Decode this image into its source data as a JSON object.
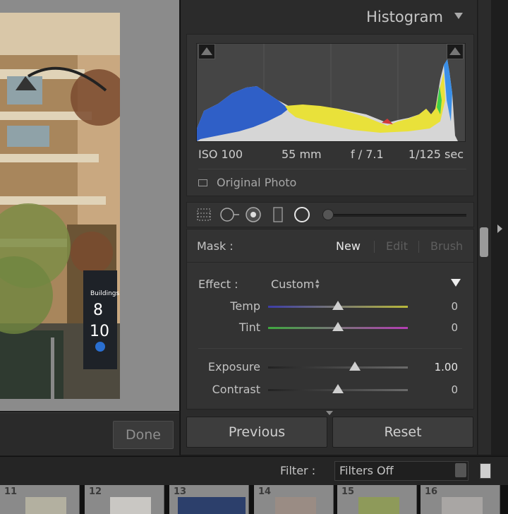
{
  "histogram": {
    "title": "Histogram",
    "iso": "ISO 100",
    "focal": "55 mm",
    "aperture": "f / 7.1",
    "shutter": "1/125 sec",
    "original_photo_label": "Original Photo"
  },
  "mask": {
    "label": "Mask :",
    "new": "New",
    "edit": "Edit",
    "brush": "Brush"
  },
  "effect": {
    "label": "Effect :",
    "value": "Custom"
  },
  "sliders": {
    "temp": {
      "label": "Temp",
      "value": "0",
      "position": 0.5
    },
    "tint": {
      "label": "Tint",
      "value": "0",
      "position": 0.5
    },
    "exposure": {
      "label": "Exposure",
      "value": "1.00",
      "position": 0.62
    },
    "contrast": {
      "label": "Contrast",
      "value": "0",
      "position": 0.5
    }
  },
  "buttons": {
    "done": "Done",
    "previous": "Previous",
    "reset": "Reset"
  },
  "filter": {
    "label": "Filter :",
    "value": "Filters Off"
  },
  "filmstrip": {
    "numbers": [
      "11",
      "12",
      "13",
      "14",
      "15",
      "16"
    ]
  }
}
